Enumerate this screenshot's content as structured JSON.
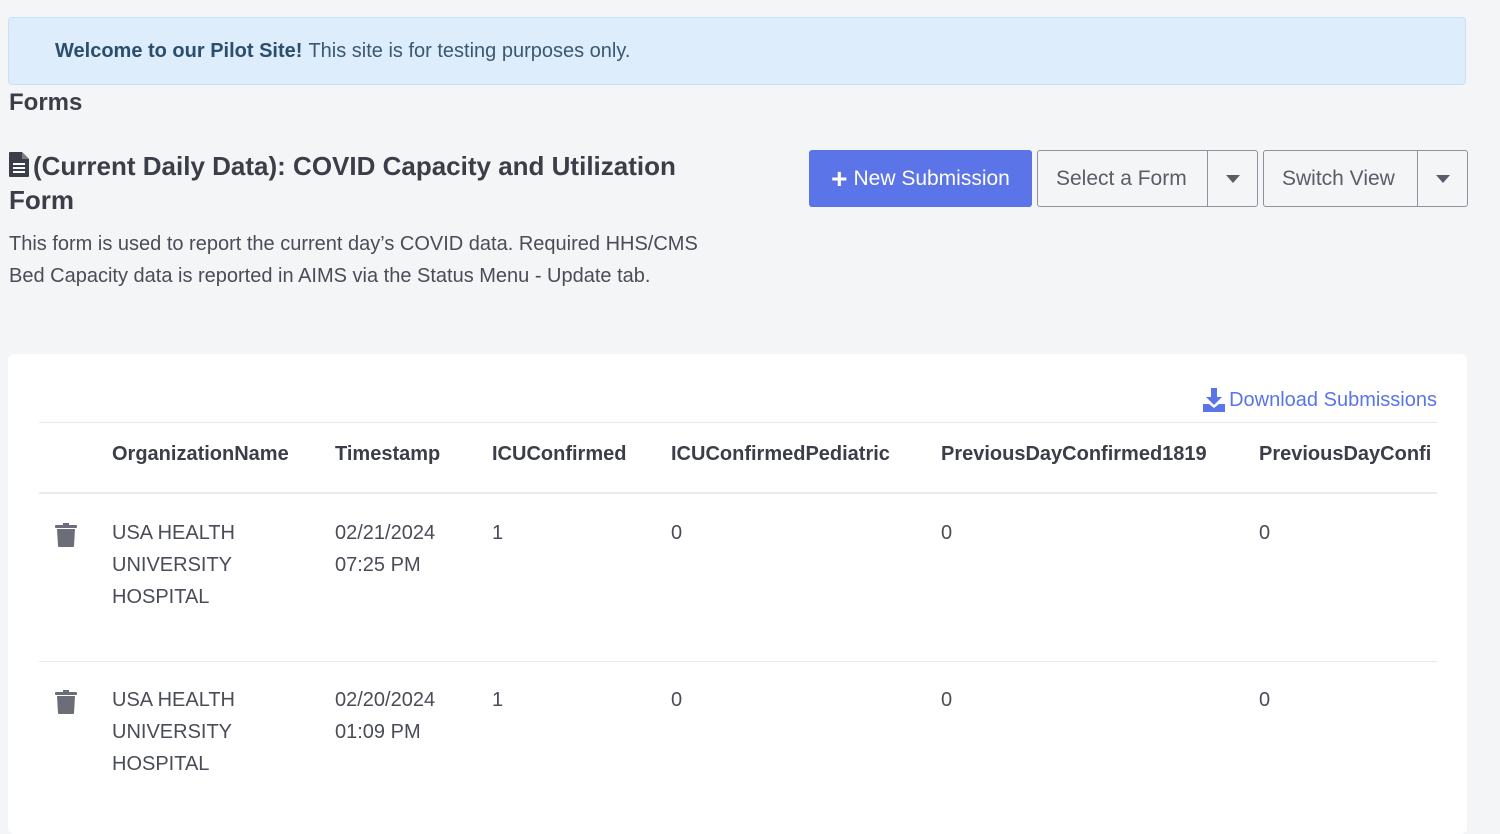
{
  "banner": {
    "bold": "Welcome to our Pilot Site!",
    "text": "This site is for testing purposes only."
  },
  "page": {
    "section_title": "Forms",
    "form_title": "(Current Daily Data): COVID Capacity and Utilization Form",
    "form_description": "This form is used to report the current day’s COVID data. Required HHS/CMS Bed Capacity data is reported in AIMS via the Status Menu - Update tab.",
    "icons": {
      "title": "file-text-icon",
      "new": "plus-icon",
      "caret": "caret-down-icon",
      "download": "download-icon",
      "delete": "trash-icon"
    }
  },
  "toolbar": {
    "new_submission": "New Submission",
    "select_form": "Select a Form",
    "switch_view": "Switch View",
    "accent_color": "#5b74e8"
  },
  "table": {
    "download_label": "Download Submissions",
    "columns": [
      "OrganizationName",
      "Timestamp",
      "ICUConfirmed",
      "ICUConfirmedPediatric",
      "PreviousDayConfirmed1819",
      "PreviousDayConfi"
    ],
    "rows": [
      {
        "org_lines": [
          "USA HEALTH",
          "UNIVERSITY",
          "HOSPITAL"
        ],
        "ts_lines": [
          "02/21/2024",
          "07:25 PM"
        ],
        "icu": "1",
        "icu_ped": "0",
        "prev1819": "0",
        "prev": "0"
      },
      {
        "org_lines": [
          "USA HEALTH",
          "UNIVERSITY",
          "HOSPITAL"
        ],
        "ts_lines": [
          "02/20/2024",
          "01:09 PM"
        ],
        "icu": "1",
        "icu_ped": "0",
        "prev1819": "0",
        "prev": "0"
      }
    ]
  }
}
